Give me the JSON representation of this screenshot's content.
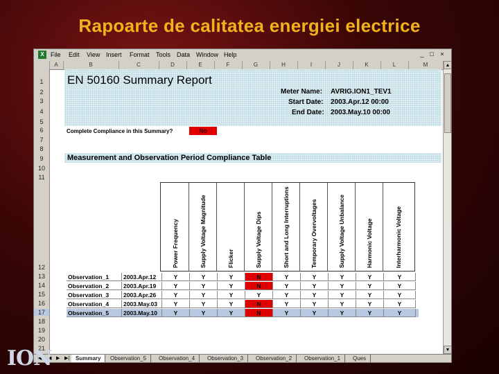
{
  "slide": {
    "title": "Rapoarte de calitatea energiei electrice",
    "logo_text": "ION"
  },
  "menubar": {
    "items": [
      "File",
      "Edit",
      "View",
      "Insert",
      "Format",
      "Tools",
      "Data",
      "Window",
      "Help"
    ],
    "win_buttons": [
      "_",
      "□",
      "×"
    ]
  },
  "columns": [
    "A",
    "B",
    "C",
    "D",
    "E",
    "F",
    "G",
    "H",
    "I",
    "J",
    "K",
    "L",
    "M"
  ],
  "rows": [
    "1",
    "2",
    "3",
    "4",
    "5",
    "6",
    "7",
    "8",
    "9",
    "10",
    "11",
    "12",
    "13",
    "14",
    "15",
    "16",
    "17",
    "18",
    "19",
    "20",
    "21"
  ],
  "report": {
    "title": "EN 50160 Summary Report",
    "meter_name_label": "Meter Name:",
    "meter_name": "AVRIG.ION1_TEV1",
    "start_date_label": "Start Date:",
    "start_date": "2003.Apr.12 00:00",
    "end_date_label": "End Date:",
    "end_date": "2003.May.10 00:00",
    "compliance_label": "Complete Compliance in this Summary?",
    "compliance_value": "No",
    "table_title": "Measurement and Observation Period Compliance Table"
  },
  "parameters": [
    "Power Frequency",
    "Supply Voltage Magnitude",
    "Flicker",
    "Supply Voltage Dips",
    "Short and Long Interruptions",
    "Temporary Overvoltages",
    "Supply Voltage Unbalance",
    "Harmonic Voltage",
    "Interharmonic Voltage"
  ],
  "observations": [
    {
      "name": "Observation_1",
      "date": "2003.Apr.12",
      "values": [
        "Y",
        "Y",
        "Y",
        "N",
        "Y",
        "Y",
        "Y",
        "Y",
        "Y"
      ]
    },
    {
      "name": "Observation_2",
      "date": "2003.Apr.19",
      "values": [
        "Y",
        "Y",
        "Y",
        "N",
        "Y",
        "Y",
        "Y",
        "Y",
        "Y"
      ]
    },
    {
      "name": "Observation_3",
      "date": "2003.Apr.26",
      "values": [
        "Y",
        "Y",
        "Y",
        "Y",
        "Y",
        "Y",
        "Y",
        "Y",
        "Y"
      ]
    },
    {
      "name": "Observation_4",
      "date": "2003.May.03",
      "values": [
        "Y",
        "Y",
        "Y",
        "N",
        "Y",
        "Y",
        "Y",
        "Y",
        "Y"
      ]
    },
    {
      "name": "Observation_5",
      "date": "2003.May.10",
      "values": [
        "Y",
        "Y",
        "Y",
        "N",
        "Y",
        "Y",
        "Y",
        "Y",
        "Y"
      ]
    }
  ],
  "tabs": [
    "Summary",
    "Observation_5",
    "Observation_4",
    "Observation_3",
    "Observation_2",
    "Observation_1",
    "Ques"
  ],
  "colors": {
    "fail": "#e00000",
    "accent": "#f2b21c"
  }
}
